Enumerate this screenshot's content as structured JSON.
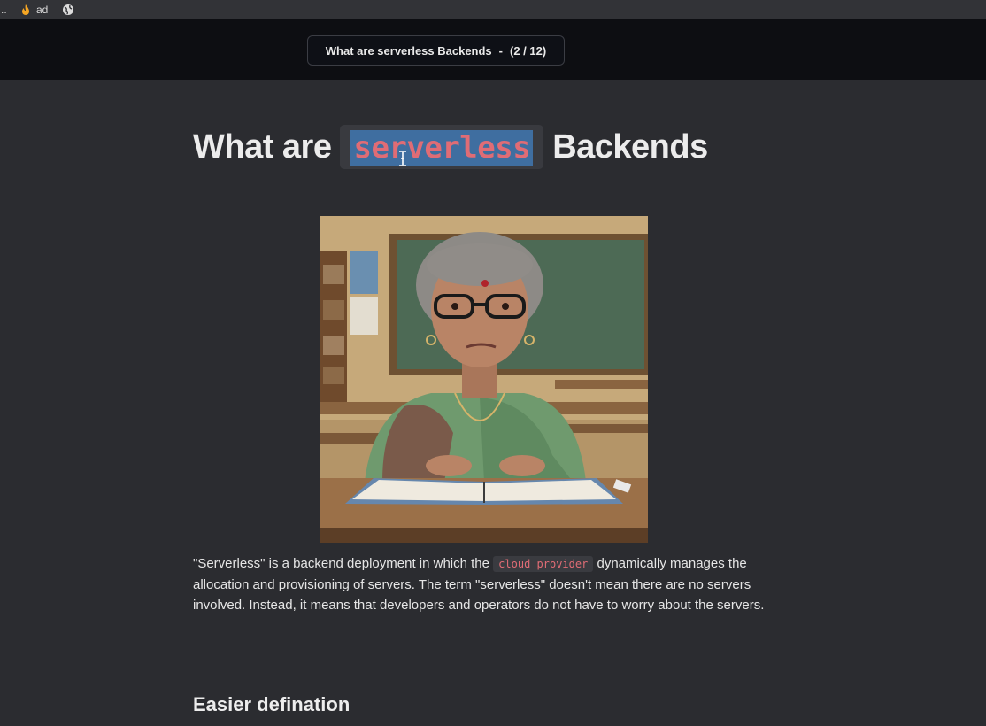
{
  "bookmarks": {
    "ellipsis": "..",
    "items": [
      {
        "label": "ad",
        "icon": "flame-favicon-icon"
      }
    ],
    "globe_icon": "globe-icon"
  },
  "header": {
    "nav_title": "What are serverless Backends",
    "separator": "-",
    "page_indicator": "(2 / 12)"
  },
  "main": {
    "title_before": "What are",
    "title_code": "serverless",
    "title_after": "Backends",
    "image_alt": "Stern elderly teacher in a green sari sitting at a desk with an open book in a classroom",
    "paragraph": {
      "part1": "\"Serverless\" is a backend deployment in which the",
      "code": "cloud provider",
      "part2": "dynamically manages the allocation and provisioning of servers. The term \"serverless\" doesn't mean there are no servers involved. Instead, it means that developers and operators do not have to worry about the servers."
    },
    "subheading": "Easier defination"
  },
  "colors": {
    "background": "#2b2c30",
    "header_bg": "#0d0e12",
    "code_text": "#e06c75",
    "selection": "#3f6ea0"
  }
}
